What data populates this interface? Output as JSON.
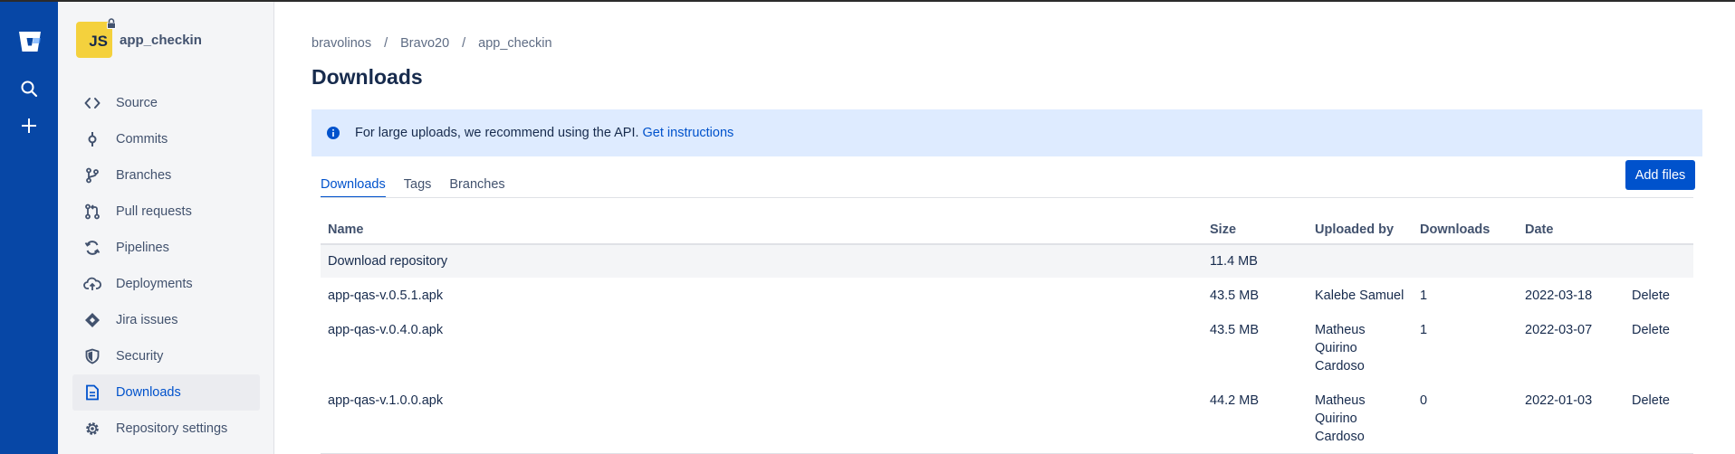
{
  "repo": {
    "initials": "JS",
    "name": "app_checkin"
  },
  "sidebar": {
    "items": [
      {
        "label": "Source",
        "icon": "source-icon"
      },
      {
        "label": "Commits",
        "icon": "commit-icon"
      },
      {
        "label": "Branches",
        "icon": "branch-icon"
      },
      {
        "label": "Pull requests",
        "icon": "pull-request-icon"
      },
      {
        "label": "Pipelines",
        "icon": "pipelines-icon"
      },
      {
        "label": "Deployments",
        "icon": "cloud-upload-icon"
      },
      {
        "label": "Jira issues",
        "icon": "jira-icon"
      },
      {
        "label": "Security",
        "icon": "shield-icon"
      },
      {
        "label": "Downloads",
        "icon": "document-icon",
        "active": true
      },
      {
        "label": "Repository settings",
        "icon": "gear-icon"
      }
    ]
  },
  "breadcrumb": [
    "bravolinos",
    "Bravo20",
    "app_checkin"
  ],
  "page_title": "Downloads",
  "banner": {
    "text": "For large uploads, we recommend using the API.",
    "link": "Get instructions"
  },
  "tabs": [
    "Downloads",
    "Tags",
    "Branches"
  ],
  "add_files_label": "Add files",
  "table": {
    "headers": [
      "Name",
      "Size",
      "Uploaded by",
      "Downloads",
      "Date"
    ],
    "repo_row": {
      "name": "Download repository",
      "size": "11.4 MB"
    },
    "rows": [
      {
        "name": "app-qas-v.0.5.1.apk",
        "size": "43.5 MB",
        "uploader": [
          "Kalebe Samuel"
        ],
        "downloads": "1",
        "date": "2022-03-18",
        "action": "Delete"
      },
      {
        "name": "app-qas-v.0.4.0.apk",
        "size": "43.5 MB",
        "uploader": [
          "Matheus",
          "Quirino",
          "Cardoso"
        ],
        "downloads": "1",
        "date": "2022-03-07",
        "action": "Delete"
      },
      {
        "name": "app-qas-v.1.0.0.apk",
        "size": "44.2 MB",
        "uploader": [
          "Matheus",
          "Quirino",
          "Cardoso"
        ],
        "downloads": "0",
        "date": "2022-01-03",
        "action": "Delete"
      }
    ]
  },
  "colors": {
    "nav": "#0747a6",
    "accent": "#0052cc",
    "banner": "#deebff",
    "avatar": "#f4d13d"
  }
}
